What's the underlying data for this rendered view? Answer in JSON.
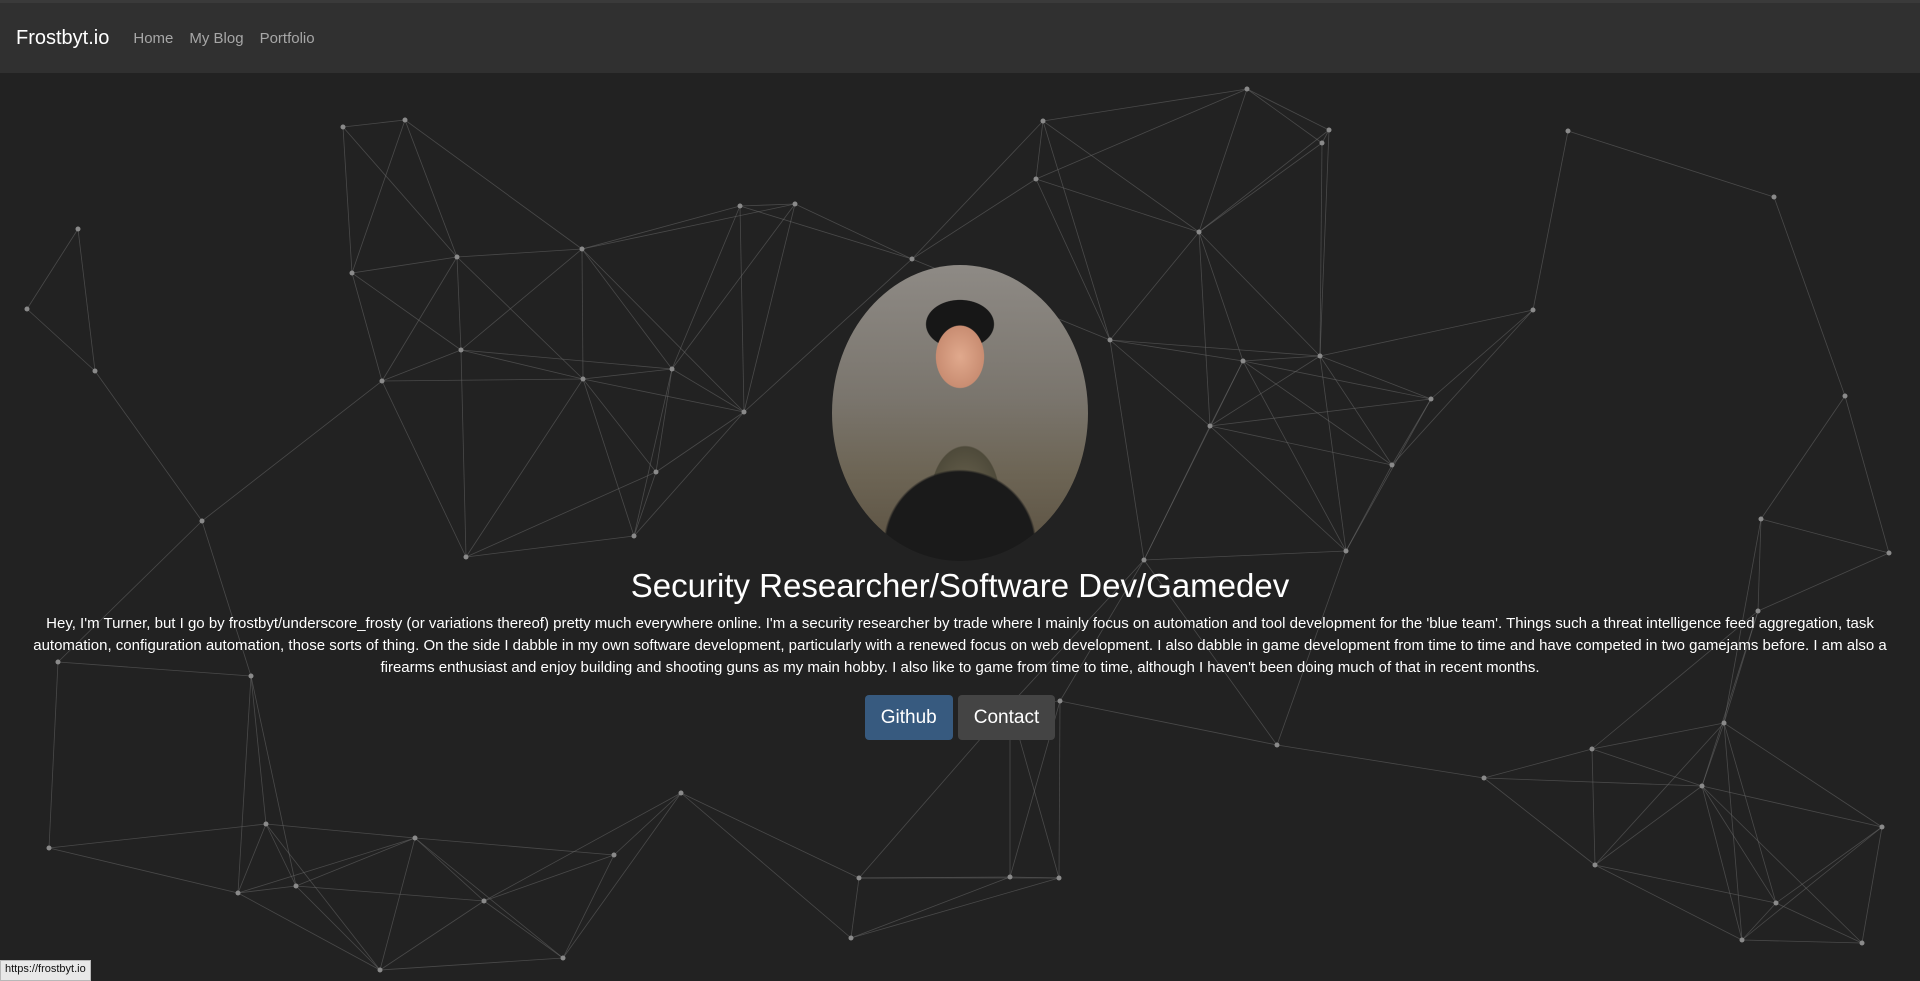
{
  "nav": {
    "brand": "Frostbyt.io",
    "links": [
      "Home",
      "My Blog",
      "Portfolio"
    ]
  },
  "hero": {
    "headline": "Security Researcher/Software Dev/Gamedev",
    "bio": "Hey, I'm Turner, but I go by frostbyt/underscore_frosty (or variations thereof) pretty much everywhere online. I'm a security researcher by trade where I mainly focus on automation and tool development for the 'blue team'. Things such a threat intelligence feed aggregation, task automation, configuration automation, those sorts of thing. On the side I dabble in my own software development, particularly with a renewed focus on web development. I also dabble in game development from time to time and have competed in two gamejams before. I am also a firearms enthusiast and enjoy building and shooting guns as my main hobby. I also like to game from time to time, although I haven't been doing much of that in recent months.",
    "buttons": {
      "github": "Github",
      "contact": "Contact"
    }
  },
  "status_url": "https://frostbyt.io",
  "colors": {
    "background": "#222222",
    "navbar": "#303030",
    "primary_button": "#375a7f",
    "secondary_button": "#444444"
  }
}
